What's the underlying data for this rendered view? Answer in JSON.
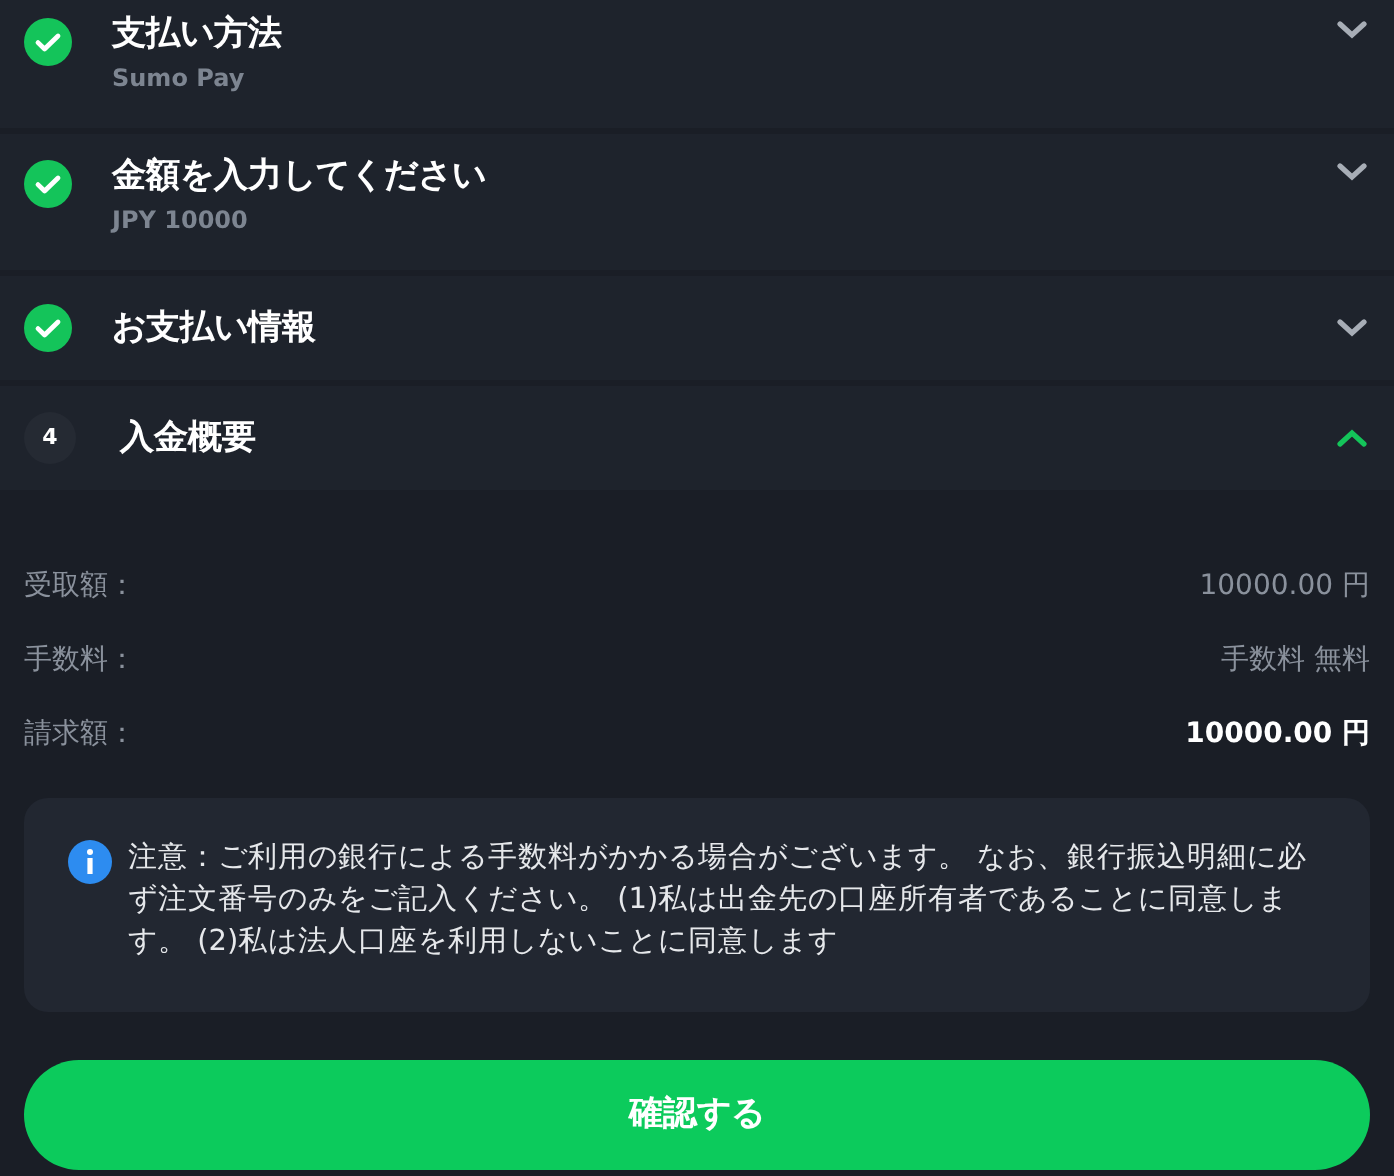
{
  "steps": [
    {
      "title": "支払い方法",
      "subtitle": "Sumo Pay",
      "completed": true,
      "expanded": false
    },
    {
      "title": "金額を入力してください",
      "subtitle": "JPY 10000",
      "completed": true,
      "expanded": false
    },
    {
      "title": "お支払い情報",
      "completed": true,
      "expanded": false
    },
    {
      "title": "入金概要",
      "number": "4",
      "completed": false,
      "expanded": true
    }
  ],
  "summary": [
    {
      "label": "受取額：",
      "value": "10000.00 円",
      "kind": "normal"
    },
    {
      "label": "手数料：",
      "value": "手数料 無料",
      "kind": "normal"
    },
    {
      "label": "請求額：",
      "value": "10000.00 円",
      "kind": "total"
    }
  ],
  "notice": "注意：ご利用の銀行による手数料がかかる場合がございます。 なお、銀行振込明細に必ず注文番号のみをご記入ください。 (1)私は出金先の口座所有者であることに同意します。 (2)私は法人口座を利用しないことに同意します",
  "confirm_button": "確認する"
}
